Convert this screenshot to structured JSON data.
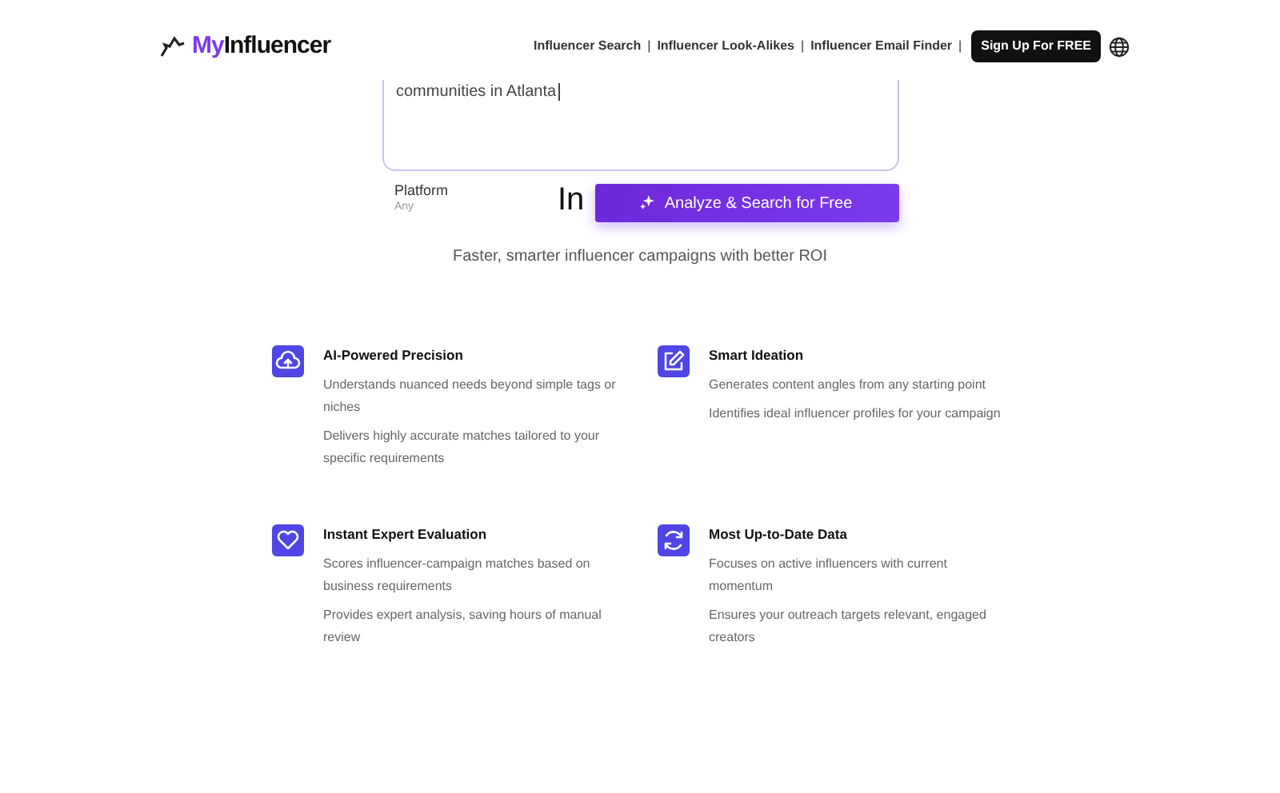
{
  "header": {
    "logo": "MyInfluencer",
    "nav": [
      {
        "label": "Influencer Search"
      },
      {
        "label": "Influencer Look-Alikes"
      },
      {
        "label": "Influencer Email Finder"
      }
    ],
    "separator": "|",
    "signup": "Sign Up For FREE"
  },
  "search": {
    "value": "communities in Atlanta",
    "platform_label": "Platform",
    "platform_value": "Any",
    "heading_fragment": "In",
    "button": "Analyze & Search for Free"
  },
  "subtitle": "Faster, smarter influencer campaigns with better ROI",
  "features": [
    {
      "kind": "cloud",
      "title": "AI-Powered Precision",
      "points": [
        "Understands nuanced needs beyond simple tags or niches",
        "Delivers highly accurate matches tailored to your specific requirements"
      ]
    },
    {
      "kind": "pencil",
      "title": "Smart Ideation",
      "points": [
        "Generates content angles from any starting point",
        "Identifies ideal influencer profiles for your campaign"
      ]
    },
    {
      "kind": "heart",
      "title": "Instant Expert Evaluation",
      "points": [
        "Scores influencer-campaign matches based on business requirements",
        "Provides expert analysis, saving hours of manual review"
      ]
    },
    {
      "kind": "refresh",
      "title": "Most Up-to-Date Data",
      "points": [
        "Focuses on active influencers with current momentum",
        "Ensures your outreach targets relevant, engaged creators"
      ]
    }
  ]
}
